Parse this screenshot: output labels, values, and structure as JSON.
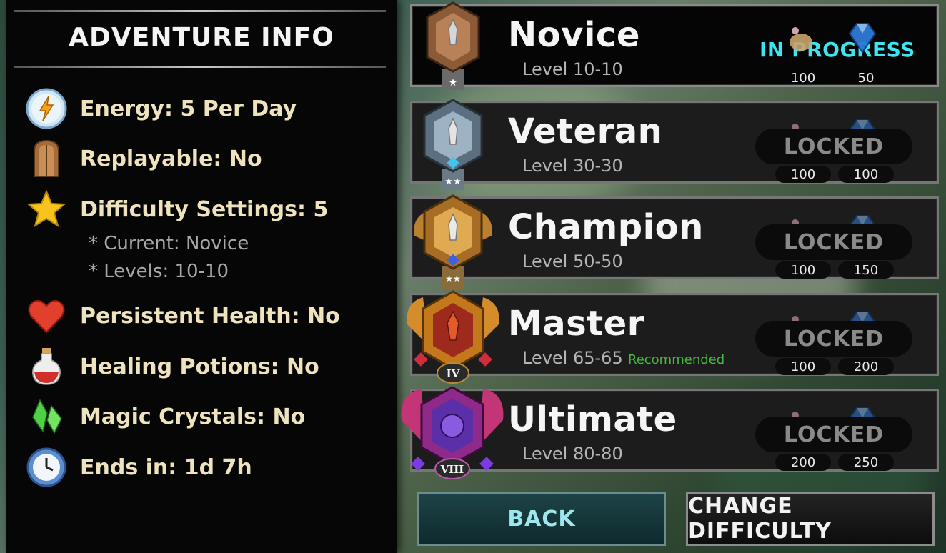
{
  "panel": {
    "title": "ADVENTURE INFO",
    "items": [
      {
        "icon": "energy-icon",
        "label": "Energy: 5 Per Day"
      },
      {
        "icon": "door-icon",
        "label": "Replayable: No"
      },
      {
        "icon": "star-icon",
        "label": "Difficulty Settings: 5"
      },
      {
        "icon": "heart-icon",
        "label": "Persistent Health: No"
      },
      {
        "icon": "potion-icon",
        "label": "Healing Potions: No"
      },
      {
        "icon": "crystal-icon",
        "label": "Magic Crystals: No"
      },
      {
        "icon": "clock-icon",
        "label": "Ends in: 1d 7h"
      }
    ],
    "sub": {
      "current": "* Current: Novice",
      "levels": "* Levels: 10-10"
    }
  },
  "difficulties": [
    {
      "name": "Novice",
      "level": "Level 10-10",
      "status": "IN PROGRESS",
      "food": "100",
      "gems": "50",
      "medal": "bronze-medal-icon",
      "tag": ""
    },
    {
      "name": "Veteran",
      "level": "Level 30-30",
      "status": "LOCKED",
      "food": "100",
      "gems": "100",
      "medal": "silver-medal-icon",
      "tag": ""
    },
    {
      "name": "Champion",
      "level": "Level 50-50",
      "status": "LOCKED",
      "food": "100",
      "gems": "150",
      "medal": "gold-medal-icon",
      "tag": ""
    },
    {
      "name": "Master",
      "level": "Level 65-65",
      "status": "LOCKED",
      "food": "100",
      "gems": "200",
      "medal": "master-medal-icon",
      "tag": "Recommended",
      "rank": "IV"
    },
    {
      "name": "Ultimate",
      "level": "Level 80-80",
      "status": "LOCKED",
      "food": "200",
      "gems": "250",
      "medal": "ultimate-medal-icon",
      "tag": "",
      "rank": "VIII"
    }
  ],
  "buttons": {
    "back": "BACK",
    "change": "CHANGE DIFFICULTY"
  },
  "colors": {
    "progress": "#3ee4f0",
    "recommended": "#47b843",
    "label": "#efe3bd"
  }
}
